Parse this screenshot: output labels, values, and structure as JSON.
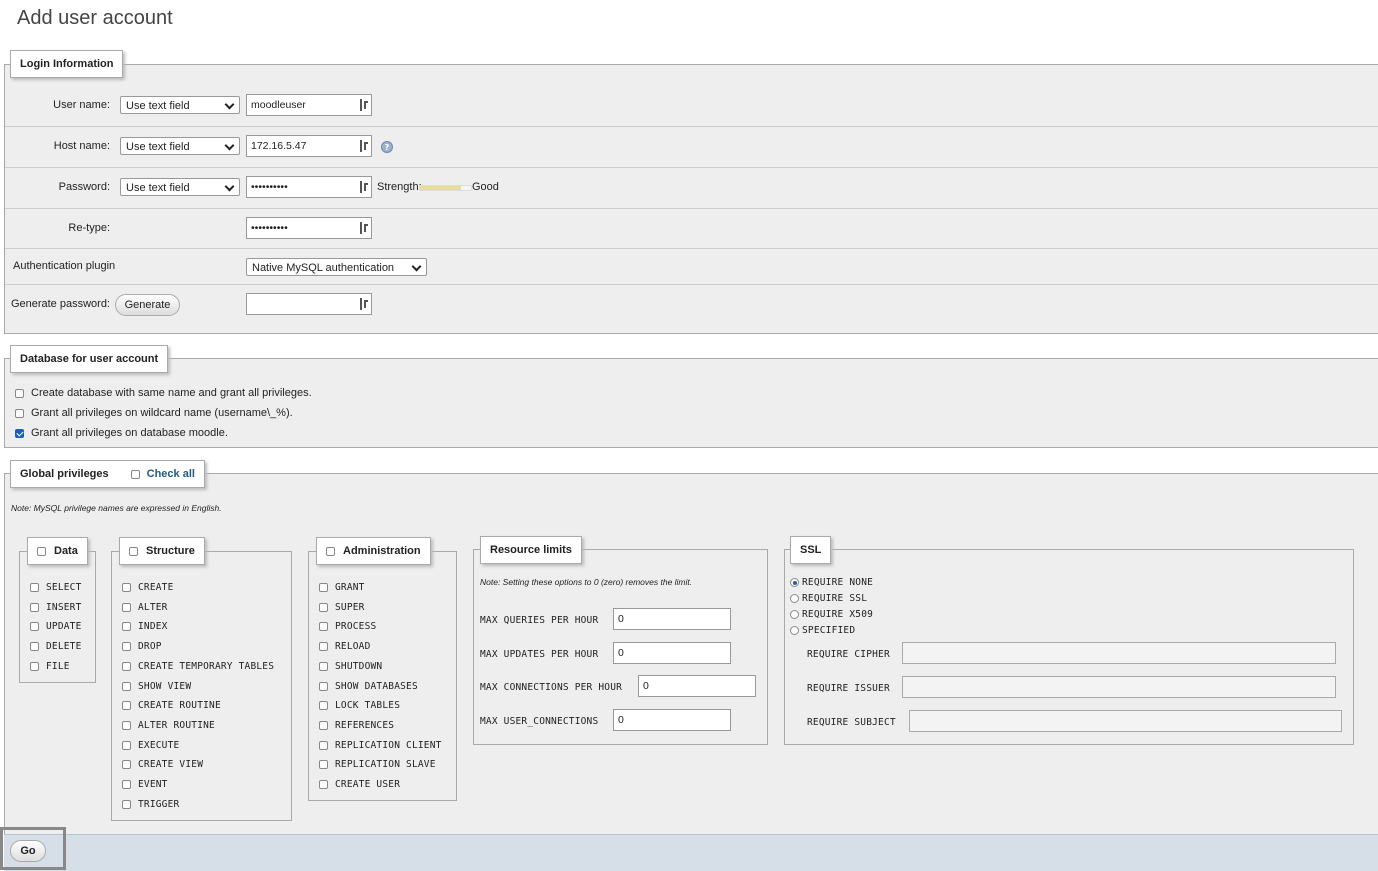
{
  "page": {
    "title": "Add user account"
  },
  "login": {
    "legend": "Login Information",
    "username": {
      "label": "User name:",
      "mode": "Use text field",
      "value": "moodleuser"
    },
    "hostname": {
      "label": "Host name:",
      "mode": "Use text field",
      "value": "172.16.5.47"
    },
    "password": {
      "label": "Password:",
      "mode": "Use text field",
      "value": "••••••••••",
      "strength_label": "Strength:",
      "strength_value": "Good",
      "strength_fraction": 0.8
    },
    "retype": {
      "label": "Re-type:",
      "value": "••••••••••"
    },
    "auth": {
      "label": "Authentication plugin",
      "value": "Native MySQL authentication"
    },
    "generate": {
      "label": "Generate password:",
      "button": "Generate",
      "value": ""
    }
  },
  "database": {
    "legend": "Database for user account",
    "options": [
      {
        "label": "Create database with same name and grant all privileges.",
        "checked": false
      },
      {
        "label": "Grant all privileges on wildcard name (username\\_%).",
        "checked": false
      },
      {
        "label": "Grant all privileges on database moodle.",
        "checked": true
      }
    ]
  },
  "global": {
    "legend": "Global privileges",
    "check_all": "Check all",
    "note": "Note: MySQL privilege names are expressed in English.",
    "data": {
      "legend": "Data",
      "items": [
        "SELECT",
        "INSERT",
        "UPDATE",
        "DELETE",
        "FILE"
      ]
    },
    "structure": {
      "legend": "Structure",
      "items": [
        "CREATE",
        "ALTER",
        "INDEX",
        "DROP",
        "CREATE TEMPORARY TABLES",
        "SHOW VIEW",
        "CREATE ROUTINE",
        "ALTER ROUTINE",
        "EXECUTE",
        "CREATE VIEW",
        "EVENT",
        "TRIGGER"
      ]
    },
    "administration": {
      "legend": "Administration",
      "items": [
        "GRANT",
        "SUPER",
        "PROCESS",
        "RELOAD",
        "SHUTDOWN",
        "SHOW DATABASES",
        "LOCK TABLES",
        "REFERENCES",
        "REPLICATION CLIENT",
        "REPLICATION SLAVE",
        "CREATE USER"
      ]
    },
    "resource": {
      "legend": "Resource limits",
      "note": "Note: Setting these options to 0 (zero) removes the limit.",
      "fields": [
        {
          "label": "MAX QUERIES PER HOUR",
          "value": "0"
        },
        {
          "label": "MAX UPDATES PER HOUR",
          "value": "0"
        },
        {
          "label": "MAX CONNECTIONS PER HOUR",
          "value": "0"
        },
        {
          "label": "MAX USER_CONNECTIONS",
          "value": "0"
        }
      ]
    },
    "ssl": {
      "legend": "SSL",
      "options": [
        {
          "label": "REQUIRE NONE",
          "checked": true
        },
        {
          "label": "REQUIRE SSL",
          "checked": false
        },
        {
          "label": "REQUIRE X509",
          "checked": false
        },
        {
          "label": "SPECIFIED",
          "checked": false
        }
      ],
      "fields": [
        {
          "label": "REQUIRE CIPHER"
        },
        {
          "label": "REQUIRE ISSUER"
        },
        {
          "label": "REQUIRE SUBJECT"
        }
      ]
    }
  },
  "footer": {
    "go": "Go"
  },
  "colors": {
    "accent": "#1a5fb4",
    "fieldset_bg": "#eeeeee",
    "footer_bg": "#d6dee8"
  }
}
